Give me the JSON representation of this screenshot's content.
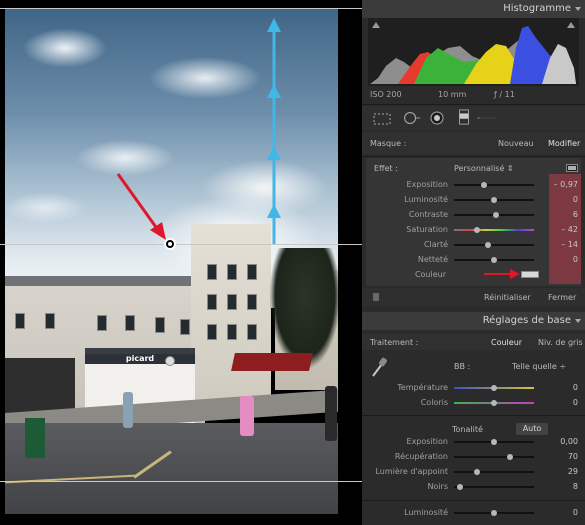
{
  "histogram": {
    "title": "Histogramme",
    "exif": {
      "iso": "ISO 200",
      "focal": "10 mm",
      "aperture": "ƒ / 11"
    },
    "colors": {
      "red": "#e63a2e",
      "green": "#3bb33b",
      "blue": "#3b4fe0",
      "yellow": "#e7d21a",
      "gray": "#9a9a9a",
      "magenta": "#c44bd2"
    }
  },
  "mask": {
    "label": "Masque :",
    "new_label": "Nouveau",
    "edit_label": "Modifier"
  },
  "effect": {
    "label": "Effet :",
    "preset": "Personnalisé ⇕",
    "rows": [
      {
        "label": "Exposition",
        "value": "– 0,97",
        "level": 0.38
      },
      {
        "label": "Luminosité",
        "value": "0",
        "level": 0.5
      },
      {
        "label": "Contraste",
        "value": "6",
        "level": 0.53
      },
      {
        "label": "Saturation",
        "value": "– 42",
        "level": 0.29
      },
      {
        "label": "Clarté",
        "value": "– 14",
        "level": 0.43
      },
      {
        "label": "Netteté",
        "value": "0",
        "level": 0.5
      }
    ],
    "color_label": "Couleur",
    "reset_label": "Réinitialiser",
    "close_label": "Fermer"
  },
  "basic": {
    "title": "Réglages de base",
    "treatment_label": "Traitement :",
    "treatment_color": "Couleur",
    "treatment_gray": "Niv. de gris",
    "wb_label": "BB :",
    "wb_value": "Telle quelle ÷",
    "wb_rows": [
      {
        "label": "Température",
        "value": "0",
        "level": 0.5
      },
      {
        "label": "Coloris",
        "value": "0",
        "level": 0.5
      }
    ],
    "tone_label": "Tonalité",
    "auto_label": "Auto",
    "tone_rows": [
      {
        "label": "Exposition",
        "value": "0,00",
        "level": 0.5
      },
      {
        "label": "Récupération",
        "value": "70",
        "level": 0.7
      },
      {
        "label": "Lumière d'appoint",
        "value": "29",
        "level": 0.29
      },
      {
        "label": "Noirs",
        "value": "8",
        "level": 0.08
      }
    ],
    "presence_rows": [
      {
        "label": "Luminosité",
        "value": "0",
        "level": 0.5
      }
    ]
  },
  "photo": {
    "shop_sign": "picard"
  }
}
